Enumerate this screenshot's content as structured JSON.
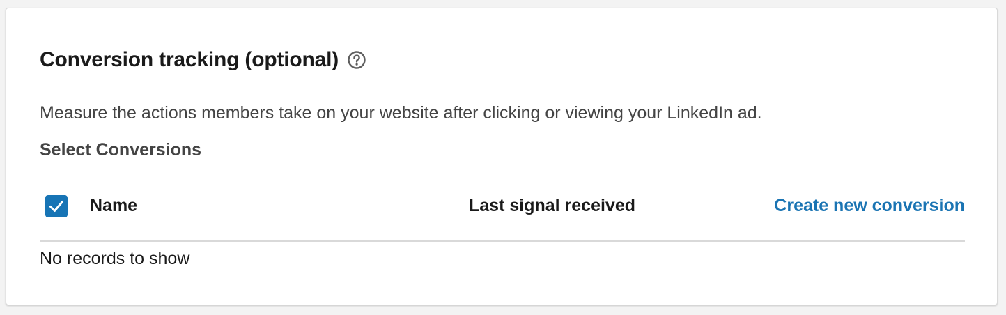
{
  "section": {
    "title": "Conversion tracking (optional)",
    "help_icon": "question-circle-icon",
    "description": "Measure the actions members take on your website after clicking or viewing your LinkedIn ad.",
    "select_label": "Select Conversions"
  },
  "table": {
    "select_all_checked": true,
    "columns": {
      "name": "Name",
      "last_signal": "Last signal received"
    },
    "create_link": "Create new conversion",
    "empty_message": "No records to show",
    "rows": []
  },
  "colors": {
    "accent": "#1774b5",
    "link": "#1a74b3",
    "text_primary": "#1a1a1a",
    "text_secondary": "#444444",
    "divider": "#d9d9d9",
    "background": "#f3f3f3",
    "card": "#ffffff"
  }
}
